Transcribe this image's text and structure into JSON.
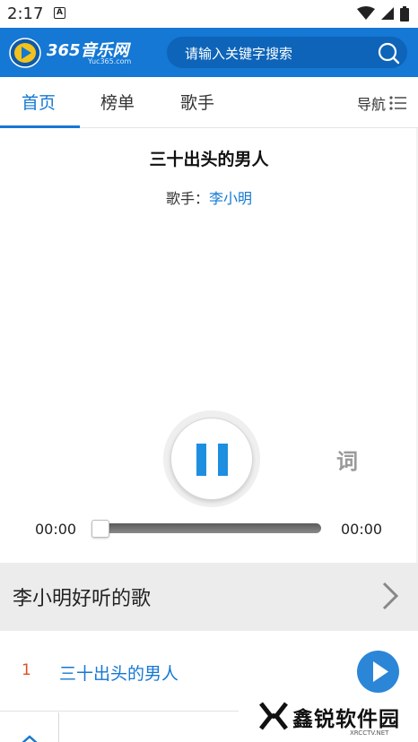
{
  "status_bar": {
    "time": "2:17",
    "notification_letter": "A"
  },
  "header": {
    "logo_brand": "365音乐网",
    "logo_sub": "Yuc365.com",
    "search_placeholder": "请输入关键字搜索"
  },
  "tabs": [
    {
      "label": "首页",
      "active": true
    },
    {
      "label": "榜单",
      "active": false
    },
    {
      "label": "歌手",
      "active": false
    }
  ],
  "nav_label": "导航",
  "player": {
    "song_title": "三十出头的男人",
    "singer_label": "歌手：",
    "singer_name": "李小明",
    "lyrics_label": "词",
    "time_current": "00:00",
    "time_total": "00:00",
    "progress": 0
  },
  "section": {
    "title": "李小明好听的歌"
  },
  "song_list": [
    {
      "num": "1",
      "name": "三十出头的男人"
    }
  ],
  "watermark": {
    "text": "鑫锐软件园",
    "sub": "XRCCTV.NET"
  },
  "colors": {
    "brand_blue": "#1478d4",
    "pause_blue": "#1e8fe0",
    "rank_orange": "#e05020"
  }
}
